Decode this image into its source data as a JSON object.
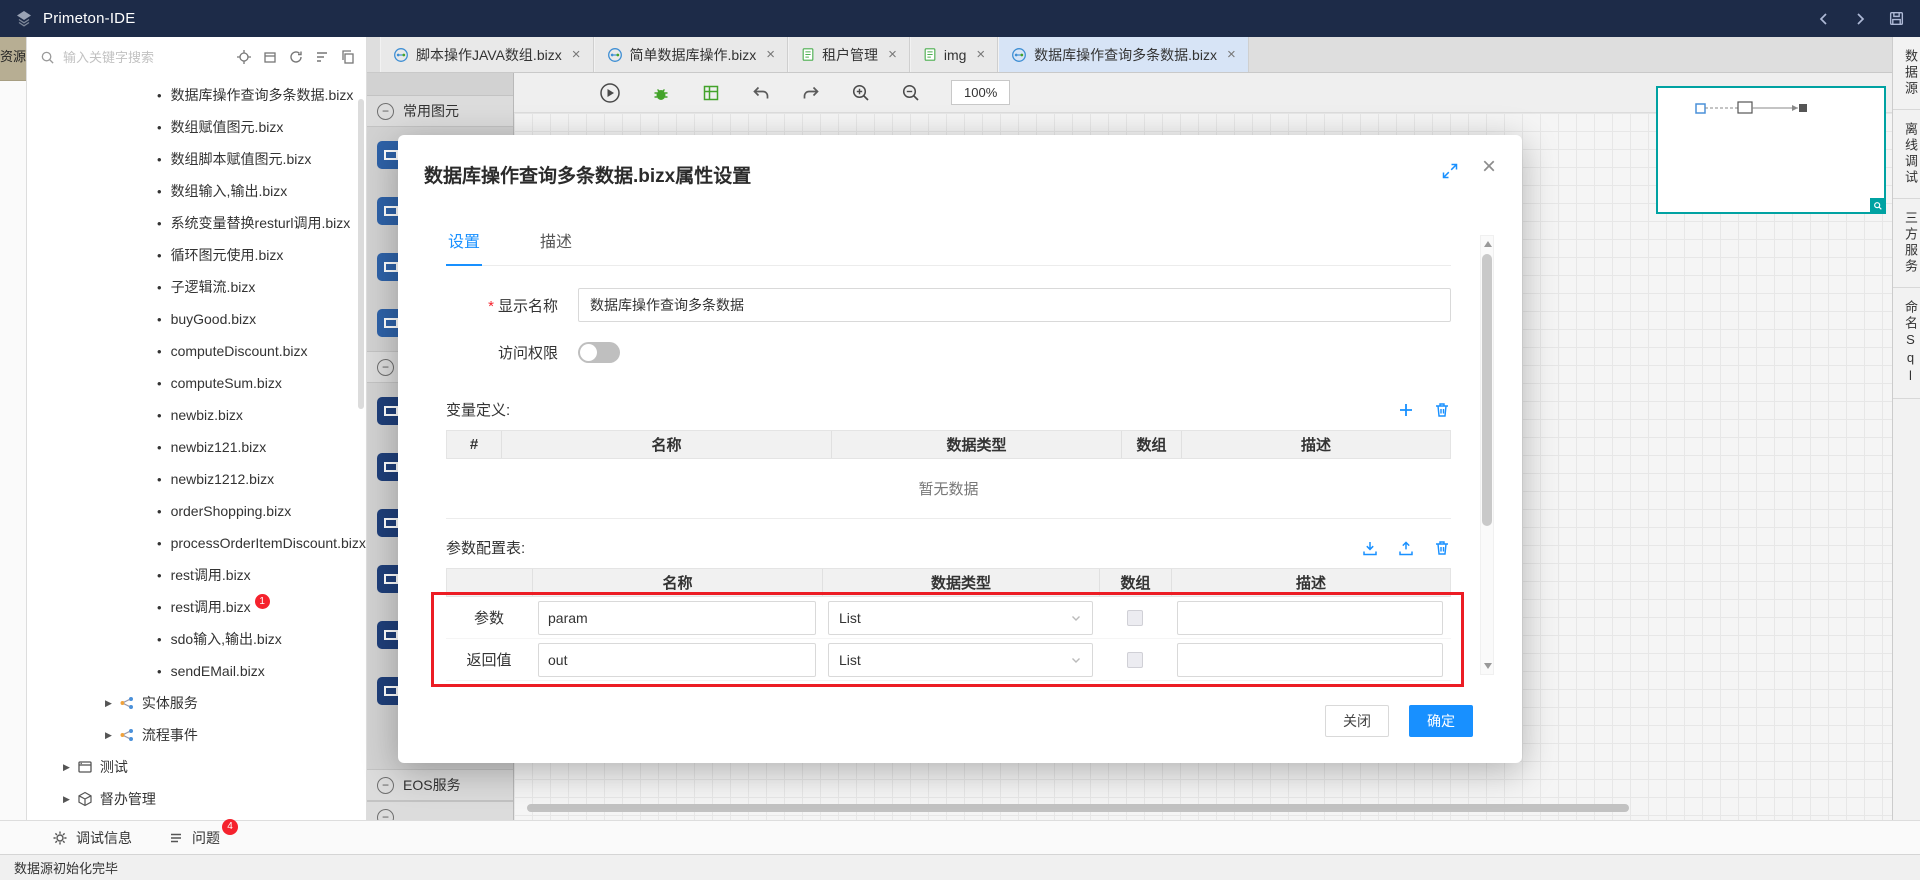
{
  "glyphs": {
    "bullet": "•",
    "arrow": "▶",
    "close": "×",
    "minus": "−"
  },
  "titlebar": {
    "title": "Primeton-IDE"
  },
  "left_strip": {
    "active_tab": "资源"
  },
  "sidebar": {
    "search": {
      "placeholder": "输入关键字搜索"
    },
    "files": [
      {
        "label": "数据库操作查询多条数据.bizx"
      },
      {
        "label": "数组赋值图元.bizx"
      },
      {
        "label": "数组脚本赋值图元.bizx"
      },
      {
        "label": "数组输入,输出.bizx"
      },
      {
        "label": "系统变量替换resturl调用.bizx"
      },
      {
        "label": "循环图元使用.bizx"
      },
      {
        "label": "子逻辑流.bizx"
      },
      {
        "label": "buyGood.bizx"
      },
      {
        "label": "computeDiscount.bizx"
      },
      {
        "label": "computeSum.bizx"
      },
      {
        "label": "newbiz.bizx"
      },
      {
        "label": "newbiz121.bizx"
      },
      {
        "label": "newbiz1212.bizx"
      },
      {
        "label": "orderShopping.bizx"
      },
      {
        "label": "processOrderItemDiscount.bizx"
      },
      {
        "label": "rest调用.bizx"
      },
      {
        "label": "rest调用.bizx",
        "badge": "1"
      },
      {
        "label": "sdo输入,输出.bizx"
      },
      {
        "label": "sendEMail.bizx"
      }
    ],
    "folders": [
      {
        "label": "实体服务"
      },
      {
        "label": "流程事件"
      }
    ],
    "roots": [
      {
        "label": "测试"
      },
      {
        "label": "督办管理"
      }
    ]
  },
  "tabbar": {
    "tabs": [
      {
        "label": "脚本操作JAVA数组.bizx"
      },
      {
        "label": "简单数据库操作.bizx"
      },
      {
        "label": "租户管理"
      },
      {
        "label": "img"
      },
      {
        "label": "数据库操作查询多条数据.bizx"
      }
    ]
  },
  "toolbar": {
    "zoom_level": "100%"
  },
  "palette": {
    "common_header": "常用图元",
    "eos_header": "EOS服务"
  },
  "right_strip": {
    "tabs": [
      {
        "label": "数据源"
      },
      {
        "label": "离线调试"
      },
      {
        "label": "三方服务"
      },
      {
        "label": "命名Sql"
      }
    ]
  },
  "bottom_bar": {
    "debug_label": "调试信息",
    "problems_label": "问题",
    "problems_badge": "4"
  },
  "statusbar": {
    "message": "数据源初始化完毕"
  },
  "dialog": {
    "title": "数据库操作查询多条数据.bizx属性设置",
    "tabs": [
      {
        "label": "设置"
      },
      {
        "label": "描述"
      }
    ],
    "form": {
      "required_mark": "*",
      "display_name_label": "显示名称",
      "display_name_value": "数据库操作查询多条数据",
      "access_label": "访问权限"
    },
    "variables": {
      "title": "变量定义:",
      "columns": [
        "#",
        "名称",
        "数据类型",
        "数组",
        "描述"
      ],
      "empty_text": "暂无数据"
    },
    "params": {
      "title": "参数配置表:",
      "columns": [
        "名称",
        "数据类型",
        "数组",
        "描述"
      ],
      "rows": [
        {
          "label": "参数",
          "name": "param",
          "type": "List",
          "desc": ""
        },
        {
          "label": "返回值",
          "name": "out",
          "type": "List",
          "desc": ""
        }
      ]
    },
    "buttons": {
      "close": "关闭",
      "confirm": "确定"
    }
  },
  "colors": {
    "accent": "#1890ff",
    "highlight_red": "#ec1c24",
    "titlebar": "#1d2b48",
    "minimap_border": "#00a2a2"
  }
}
